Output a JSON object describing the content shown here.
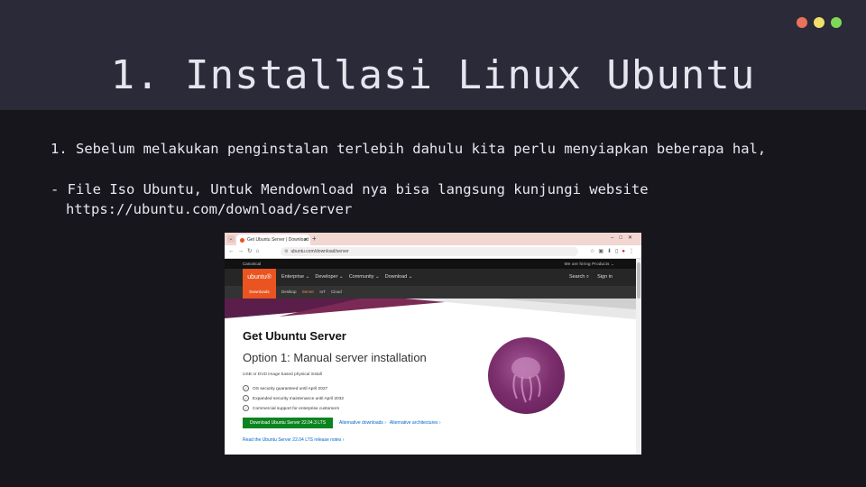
{
  "slide": {
    "title": "1. Installasi Linux Ubuntu",
    "line1": "1. Sebelum melakukan penginstalan terlebih dahulu kita perlu menyiapkan beberapa hal,",
    "line2": "- File Iso Ubuntu, Untuk Mendownload nya bisa langsung kunjungi website",
    "line3": "https://ubuntu.com/download/server",
    "dots": [
      "#e8735a",
      "#f0e06a",
      "#7ed957"
    ]
  },
  "browser": {
    "tab_title": "Get Ubuntu Server | Download",
    "url": "ubuntu.com/download/server"
  },
  "site": {
    "canonical": "Canonical",
    "top_right": "We are hiring    Products ⌄",
    "logo": "ubuntu®",
    "menu": [
      "Enterprise ⌄",
      "Developer ⌄",
      "Community ⌄",
      "Download ⌄"
    ],
    "search": "Search",
    "signin": "Sign in",
    "subnav_active": "Downloads",
    "subnav": [
      "Desktop",
      "Server",
      "IoT",
      "Cloud"
    ],
    "heading": "Get Ubuntu Server",
    "option": "Option 1: Manual server installation",
    "usb": "USB or DVD image based physical install",
    "features": [
      "OS security guaranteed until April 2027",
      "Expanded security maintenance until April 2032",
      "Commercial support for enterprise customers"
    ],
    "download_button": "Download Ubuntu Server 22.04.3 LTS",
    "alt_downloads": "Alternative downloads ›",
    "alt_arch": "Alternative architectures ›",
    "release_notes": "Read the Ubuntu Server 22.04 LTS release notes ›"
  }
}
